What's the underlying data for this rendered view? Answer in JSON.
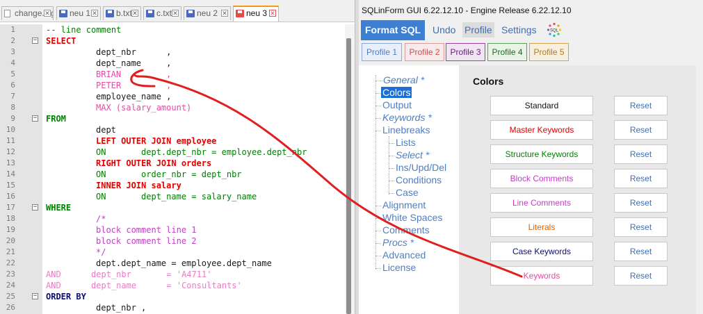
{
  "tabs": [
    {
      "label": "change.log",
      "icon": "doc-icon"
    },
    {
      "label": "neu 1",
      "icon": "saved-file-icon"
    },
    {
      "label": "b.txt",
      "icon": "saved-file-icon"
    },
    {
      "label": "c.txt",
      "icon": "saved-file-icon"
    },
    {
      "label": "neu 2",
      "icon": "saved-file-icon"
    },
    {
      "label": "neu 3",
      "icon": "unsaved-file-icon"
    }
  ],
  "editor": {
    "lines": [
      {
        "n": "1",
        "t": "-- line comment"
      },
      {
        "n": "2",
        "t": "SELECT"
      },
      {
        "n": "3",
        "t": "dept_nbr      ,"
      },
      {
        "n": "4",
        "t": "dept_name     ,"
      },
      {
        "n": "5",
        "t": "BRIAN         ,"
      },
      {
        "n": "6",
        "t": "PETER         ,"
      },
      {
        "n": "7",
        "t": "employee_name ,"
      },
      {
        "n": "8",
        "t": "MAX (salary_amount)"
      },
      {
        "n": "9",
        "t": "FROM"
      },
      {
        "n": "10",
        "t": "dept"
      },
      {
        "n": "11",
        "t": "LEFT OUTER JOIN employee"
      },
      {
        "n": "12",
        "t": "ON       dept.dept_nbr = employee.dept_nbr"
      },
      {
        "n": "13",
        "t": "RIGHT OUTER JOIN orders"
      },
      {
        "n": "14",
        "t": "ON       order_nbr = dept_nbr"
      },
      {
        "n": "15",
        "t": "INNER JOIN salary"
      },
      {
        "n": "16",
        "t": "ON       dept_name = salary_name"
      },
      {
        "n": "17",
        "t": "WHERE"
      },
      {
        "n": "18",
        "t": "/*"
      },
      {
        "n": "19",
        "t": "block comment line 1"
      },
      {
        "n": "20",
        "t": "block comment line 2"
      },
      {
        "n": "21",
        "t": "*/"
      },
      {
        "n": "22",
        "t": "dept.dept_name = employee.dept_name"
      },
      {
        "n": "23",
        "t": "AND      dept_nbr       = 'A4711'"
      },
      {
        "n": "24",
        "t": "AND      dept_name      = 'Consultants'"
      },
      {
        "n": "25",
        "t": "ORDER BY"
      },
      {
        "n": "26",
        "t": "dept_nbr ,"
      }
    ]
  },
  "panel": {
    "title": "SQLinForm GUI 6.22.12.10 - Engine Release 6.22.12.10",
    "format_label": "Format SQL",
    "undo_label": "Undo",
    "profile_label": "Profile",
    "settings_label": "Settings",
    "logo_text": "SQL",
    "profiles": [
      "Profile 1",
      "Profile 2",
      "Profile 3",
      "Profile 4",
      "Profile 5"
    ],
    "colors": {
      "selected_bg": "#1f6fd3",
      "accent": "#3d7fd1",
      "annotation": "#e02020"
    },
    "nav": [
      {
        "label": "General *",
        "italic": true
      },
      {
        "label": "Colors",
        "selected": true
      },
      {
        "label": "Output"
      },
      {
        "label": "Keywords *",
        "italic": true
      },
      {
        "label": "Linebreaks"
      },
      {
        "label": "Lists"
      },
      {
        "label": "Select *",
        "italic": true
      },
      {
        "label": "Ins/Upd/Del"
      },
      {
        "label": "Conditions"
      },
      {
        "label": "Case"
      },
      {
        "label": "Alignment"
      },
      {
        "label": "White Spaces"
      },
      {
        "label": "Comments"
      },
      {
        "label": "Procs *",
        "italic": true
      },
      {
        "label": "Advanced"
      },
      {
        "label": "License"
      }
    ],
    "section_title": "Colors",
    "color_rows": [
      {
        "label": "Standard",
        "color": "#111111"
      },
      {
        "label": "Master Keywords",
        "color": "#e30000"
      },
      {
        "label": "Structure Keywords",
        "color": "#008000"
      },
      {
        "label": "Block Comments",
        "color": "#c33ec6"
      },
      {
        "label": "Line Comments",
        "color": "#c33ec6"
      },
      {
        "label": "Literals",
        "color": "#e06000"
      },
      {
        "label": "Case Keywords",
        "color": "#0d0d6e"
      },
      {
        "label": "Keywords",
        "color": "#e34ca3"
      }
    ],
    "reset_label": "Reset"
  }
}
